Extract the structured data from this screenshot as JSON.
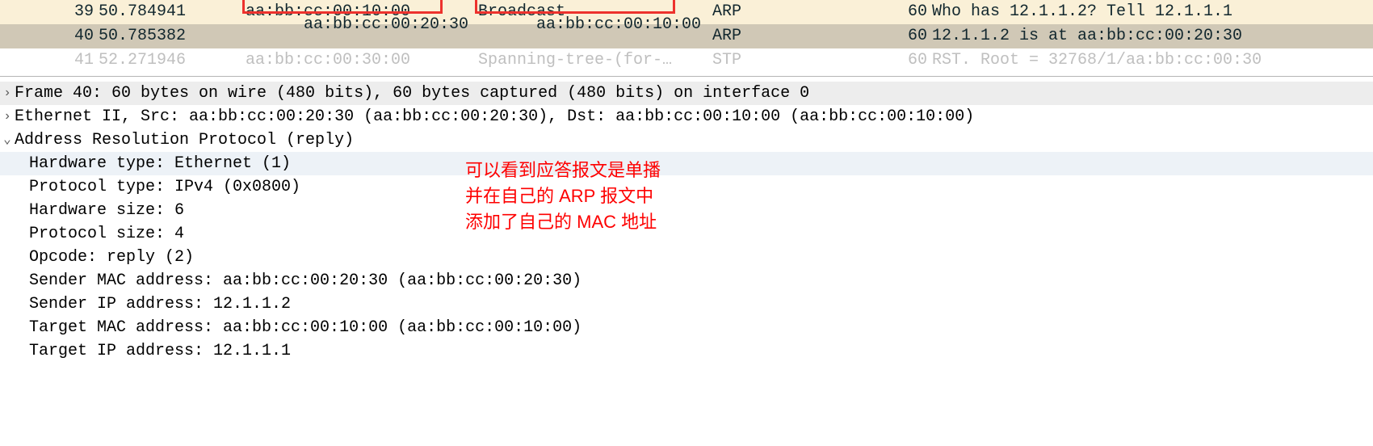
{
  "packets": {
    "row0": {
      "num": "39",
      "time": "50.784941",
      "src": "aa:bb:cc:00:10:00",
      "dst": "Broadcast",
      "proto": "ARP",
      "len": "60",
      "info": "Who has 12.1.1.2? Tell 12.1.1.1"
    },
    "row1": {
      "num": "40",
      "time": "50.785382",
      "src": "aa:bb:cc:00:20:30",
      "dst": "aa:bb:cc:00:10:00",
      "proto": "ARP",
      "len": "60",
      "info": "12.1.1.2 is at aa:bb:cc:00:20:30"
    },
    "row2": {
      "num": "41",
      "time": "52.271946",
      "src": "aa:bb:cc:00:30:00",
      "dst": "Spanning-tree-(for-…",
      "proto": "STP",
      "len": "60",
      "info": "RST. Root = 32768/1/aa:bb:cc:00:30"
    }
  },
  "details": {
    "frame": "Frame 40: 60 bytes on wire (480 bits), 60 bytes captured (480 bits) on interface 0",
    "eth": "Ethernet II, Src: aa:bb:cc:00:20:30 (aa:bb:cc:00:20:30), Dst: aa:bb:cc:00:10:00 (aa:bb:cc:00:10:00)",
    "arp": "Address Resolution Protocol (reply)",
    "hwtype": "Hardware type: Ethernet (1)",
    "ptype": "Protocol type: IPv4 (0x0800)",
    "hwsize": "Hardware size: 6",
    "psize": "Protocol size: 4",
    "opcode": "Opcode: reply (2)",
    "smac": "Sender MAC address: aa:bb:cc:00:20:30 (aa:bb:cc:00:20:30)",
    "sip": "Sender IP address: 12.1.1.2",
    "tmac": "Target MAC address: aa:bb:cc:00:10:00 (aa:bb:cc:00:10:00)",
    "tip": "Target IP address: 12.1.1.1"
  },
  "annotation": {
    "line1": "可以看到应答报文是单播",
    "line2": "并在自己的 ARP 报文中",
    "line3": "添加了自己的 MAC 地址"
  },
  "glyphs": {
    "collapsed": "›",
    "expanded": "⌄"
  }
}
